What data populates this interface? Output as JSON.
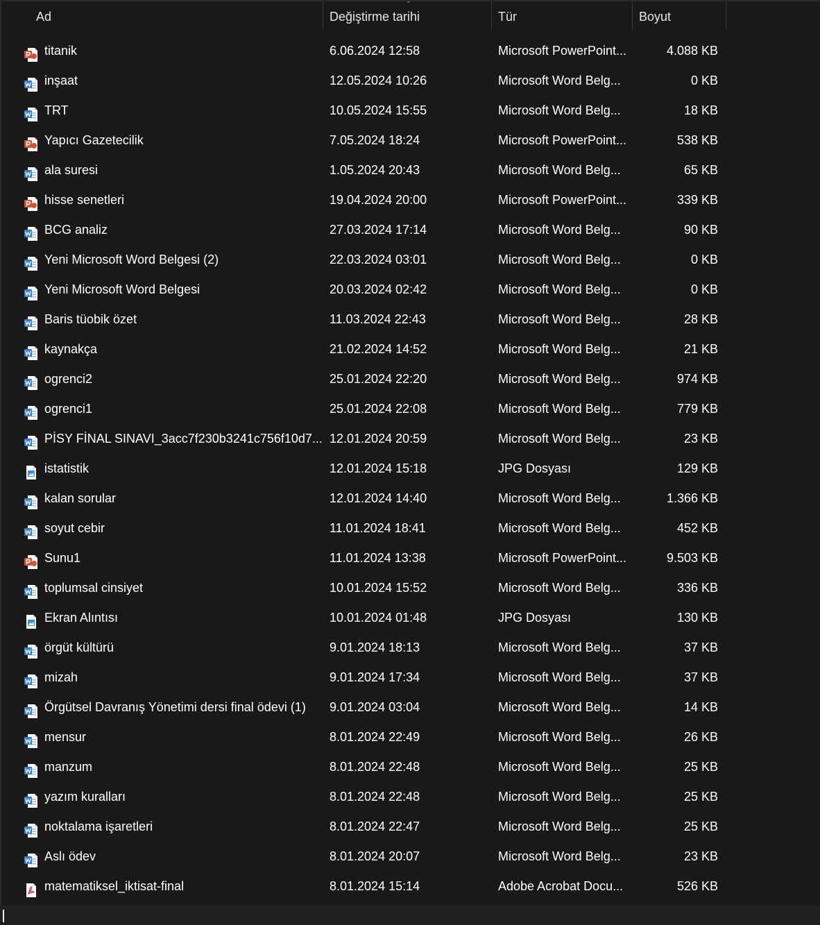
{
  "columns": {
    "name": "Ad",
    "date": "Değiştirme tarihi",
    "type": "Tür",
    "size": "Boyut"
  },
  "sort_indicator": "ˇ",
  "colors": {
    "background": "#191919",
    "word": "#2b7cd3",
    "powerpoint": "#d35230",
    "pdf": "#e02a2a",
    "image": "#3a8ee6"
  },
  "files": [
    {
      "name": "titanik",
      "date": "6.06.2024 12:58",
      "type": "Microsoft PowerPoint...",
      "size": "4.088 KB",
      "icon": "powerpoint-icon"
    },
    {
      "name": "inşaat",
      "date": "12.05.2024 10:26",
      "type": "Microsoft Word Belg...",
      "size": "0 KB",
      "icon": "word-icon"
    },
    {
      "name": "TRT",
      "date": "10.05.2024 15:55",
      "type": "Microsoft Word Belg...",
      "size": "18 KB",
      "icon": "word-icon"
    },
    {
      "name": "Yapıcı Gazetecilik",
      "date": "7.05.2024 18:24",
      "type": "Microsoft PowerPoint...",
      "size": "538 KB",
      "icon": "powerpoint-icon"
    },
    {
      "name": "ala suresi",
      "date": "1.05.2024 20:43",
      "type": "Microsoft Word Belg...",
      "size": "65 KB",
      "icon": "word-icon"
    },
    {
      "name": "hisse senetleri",
      "date": "19.04.2024 20:00",
      "type": "Microsoft PowerPoint...",
      "size": "339 KB",
      "icon": "powerpoint-icon"
    },
    {
      "name": "BCG analiz",
      "date": "27.03.2024 17:14",
      "type": "Microsoft Word Belg...",
      "size": "90 KB",
      "icon": "word-icon"
    },
    {
      "name": "Yeni Microsoft Word Belgesi (2)",
      "date": "22.03.2024 03:01",
      "type": "Microsoft Word Belg...",
      "size": "0 KB",
      "icon": "word-icon"
    },
    {
      "name": "Yeni Microsoft Word Belgesi",
      "date": "20.03.2024 02:42",
      "type": "Microsoft Word Belg...",
      "size": "0 KB",
      "icon": "word-icon"
    },
    {
      "name": "Baris tüobik özet",
      "date": "11.03.2024 22:43",
      "type": "Microsoft Word Belg...",
      "size": "28 KB",
      "icon": "word-icon"
    },
    {
      "name": "kaynakça",
      "date": "21.02.2024 14:52",
      "type": "Microsoft Word Belg...",
      "size": "21 KB",
      "icon": "word-icon"
    },
    {
      "name": "ogrenci2",
      "date": "25.01.2024 22:20",
      "type": "Microsoft Word Belg...",
      "size": "974 KB",
      "icon": "word-icon"
    },
    {
      "name": "ogrenci1",
      "date": "25.01.2024 22:08",
      "type": "Microsoft Word Belg...",
      "size": "779 KB",
      "icon": "word-icon"
    },
    {
      "name": "PİSY FİNAL SINAVI_3acc7f230b3241c756f10d7...",
      "date": "12.01.2024 20:59",
      "type": "Microsoft Word Belg...",
      "size": "23 KB",
      "icon": "word-icon"
    },
    {
      "name": "istatistik",
      "date": "12.01.2024 15:18",
      "type": "JPG Dosyası",
      "size": "129 KB",
      "icon": "image-file-icon"
    },
    {
      "name": "kalan sorular",
      "date": "12.01.2024 14:40",
      "type": "Microsoft Word Belg...",
      "size": "1.366 KB",
      "icon": "word-icon"
    },
    {
      "name": "soyut cebir",
      "date": "11.01.2024 18:41",
      "type": "Microsoft Word Belg...",
      "size": "452 KB",
      "icon": "word-icon"
    },
    {
      "name": "Sunu1",
      "date": "11.01.2024 13:38",
      "type": "Microsoft PowerPoint...",
      "size": "9.503 KB",
      "icon": "powerpoint-icon"
    },
    {
      "name": "toplumsal cinsiyet",
      "date": "10.01.2024 15:52",
      "type": "Microsoft Word Belg...",
      "size": "336 KB",
      "icon": "word-icon"
    },
    {
      "name": "Ekran Alıntısı",
      "date": "10.01.2024 01:48",
      "type": "JPG Dosyası",
      "size": "130 KB",
      "icon": "image-file-icon"
    },
    {
      "name": "örgüt kültürü",
      "date": "9.01.2024 18:13",
      "type": "Microsoft Word Belg...",
      "size": "37 KB",
      "icon": "word-icon"
    },
    {
      "name": "mizah",
      "date": "9.01.2024 17:34",
      "type": "Microsoft Word Belg...",
      "size": "37 KB",
      "icon": "word-icon"
    },
    {
      "name": "Örgütsel Davranış Yönetimi dersi final ödevi (1)",
      "date": "9.01.2024 03:04",
      "type": "Microsoft Word Belg...",
      "size": "14 KB",
      "icon": "word-icon"
    },
    {
      "name": "mensur",
      "date": "8.01.2024 22:49",
      "type": "Microsoft Word Belg...",
      "size": "26 KB",
      "icon": "word-icon"
    },
    {
      "name": "manzum",
      "date": "8.01.2024 22:48",
      "type": "Microsoft Word Belg...",
      "size": "25 KB",
      "icon": "word-icon"
    },
    {
      "name": "yazım kuralları",
      "date": "8.01.2024 22:48",
      "type": "Microsoft Word Belg...",
      "size": "25 KB",
      "icon": "word-icon"
    },
    {
      "name": "noktalama işaretleri",
      "date": "8.01.2024 22:47",
      "type": "Microsoft Word Belg...",
      "size": "25 KB",
      "icon": "word-icon"
    },
    {
      "name": "Aslı ödev",
      "date": "8.01.2024 20:07",
      "type": "Microsoft Word Belg...",
      "size": "23 KB",
      "icon": "word-icon"
    },
    {
      "name": "matematiksel_iktisat-final",
      "date": "8.01.2024 15:14",
      "type": "Adobe Acrobat Docu...",
      "size": "526 KB",
      "icon": "pdf-icon"
    }
  ]
}
